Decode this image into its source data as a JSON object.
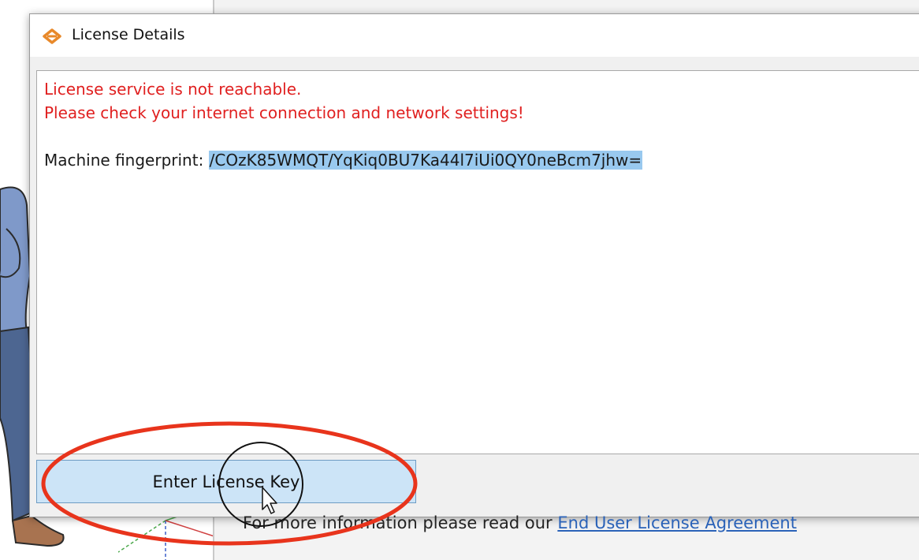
{
  "dialog": {
    "title": "License Details",
    "error_line_1": "License service is not reachable.",
    "error_line_2": "Please check your internet connection and network settings!",
    "fingerprint_label": "Machine fingerprint: ",
    "fingerprint_value": "/COzK85WMQT/YqKiq0BU7Ka44l7iUi0QY0neBcm7jhw=",
    "button_label": "Enter License Key",
    "footer_text": "For more information please read our ",
    "footer_link": "End User License Agreement"
  },
  "colors": {
    "error_text": "#e02020",
    "selection": "#99c9ef",
    "button_bg": "#cce4f7",
    "link": "#2a62b8",
    "annotation": "#e8341c"
  },
  "icons": [
    "app-logo-icon",
    "mouse-cursor-icon"
  ]
}
